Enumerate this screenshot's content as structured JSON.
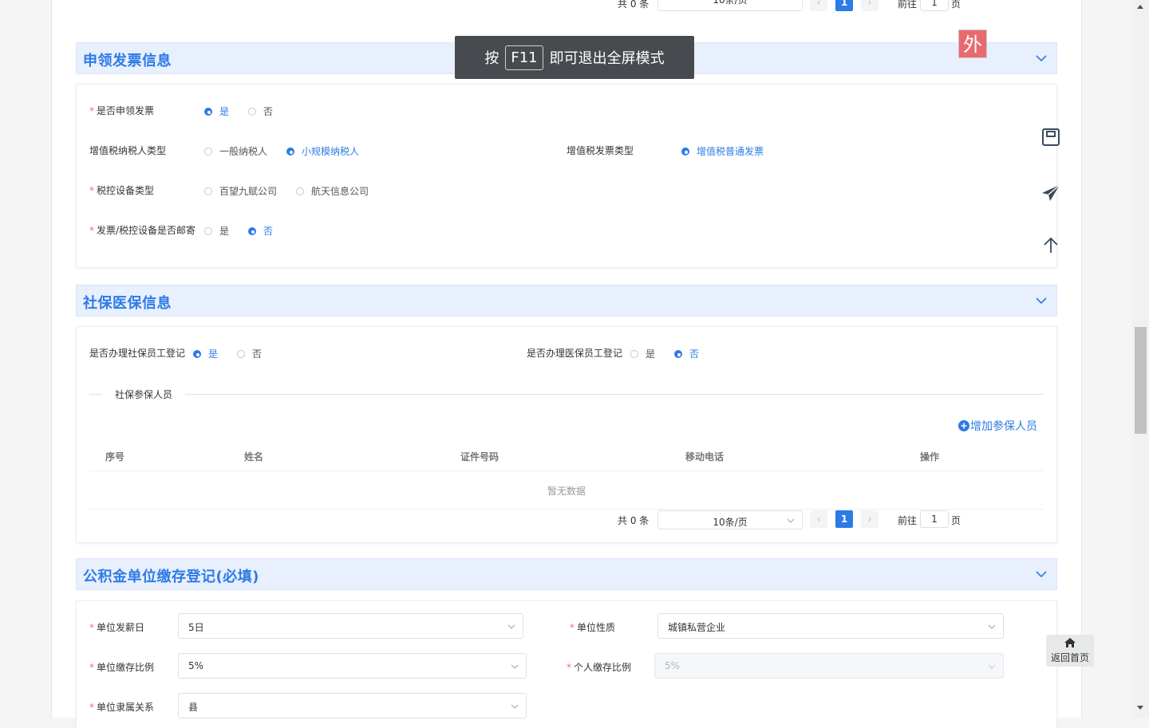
{
  "top_pager": {
    "total": "共 0 条",
    "page_size": "10条/页",
    "current_page": "1",
    "goto_label": "前往",
    "goto_value": "1",
    "page_suffix": "页"
  },
  "toast": {
    "prefix": "按",
    "key": "F11",
    "suffix": "即可退出全屏模式"
  },
  "badge": {
    "text": "外"
  },
  "invoice_section": {
    "title": "申领发票信息",
    "apply_invoice": {
      "label": "是否申领发票",
      "options": [
        "是",
        "否"
      ],
      "selected": "是"
    },
    "taxpayer_type": {
      "label": "增值税纳税人类型",
      "options": [
        "一般纳税人",
        "小规模纳税人"
      ],
      "selected": "小规模纳税人"
    },
    "invoice_type": {
      "label": "增值税发票类型",
      "options": [
        "增值税普通发票"
      ],
      "selected": "增值税普通发票"
    },
    "device_type": {
      "label": "税控设备类型",
      "options": [
        "百望九赋公司",
        "航天信息公司"
      ],
      "selected": ""
    },
    "mail": {
      "label": "发票/税控设备是否邮寄",
      "options": [
        "是",
        "否"
      ],
      "selected": "否"
    }
  },
  "social_section": {
    "title": "社保医保信息",
    "social_register": {
      "label": "是否办理社保员工登记",
      "options": [
        "是",
        "否"
      ],
      "selected": "是"
    },
    "medical_register": {
      "label": "是否办理医保员工登记",
      "options": [
        "是",
        "否"
      ],
      "selected": "否"
    },
    "divider_label": "社保参保人员",
    "add_button": "增加参保人员",
    "table_headers": [
      "序号",
      "姓名",
      "证件号码",
      "移动电话",
      "操作"
    ],
    "empty_text": "暂无数据",
    "pager": {
      "total": "共 0 条",
      "page_size": "10条/页",
      "current_page": "1",
      "goto_label": "前往",
      "goto_value": "1",
      "page_suffix": "页"
    }
  },
  "fund_section": {
    "title": "公积金单位缴存登记(必填)",
    "pay_day": {
      "label": "单位发薪日",
      "value": "5日"
    },
    "unit_nature": {
      "label": "单位性质",
      "value": "城镇私营企业"
    },
    "unit_ratio": {
      "label": "单位缴存比例",
      "value": "5%"
    },
    "personal_ratio": {
      "label": "个人缴存比例",
      "value": "5%"
    },
    "affiliation": {
      "label": "单位隶属关系",
      "value": "县"
    }
  },
  "home_button": {
    "label": "返回首页"
  },
  "colors": {
    "accent": "#2d7be5",
    "header_bg": "#e8effd",
    "required": "#f56c6c"
  },
  "icons": [
    "chevron-down-icon",
    "save-icon",
    "send-icon",
    "arrow-up-icon",
    "home-icon",
    "plus-circle-icon"
  ]
}
